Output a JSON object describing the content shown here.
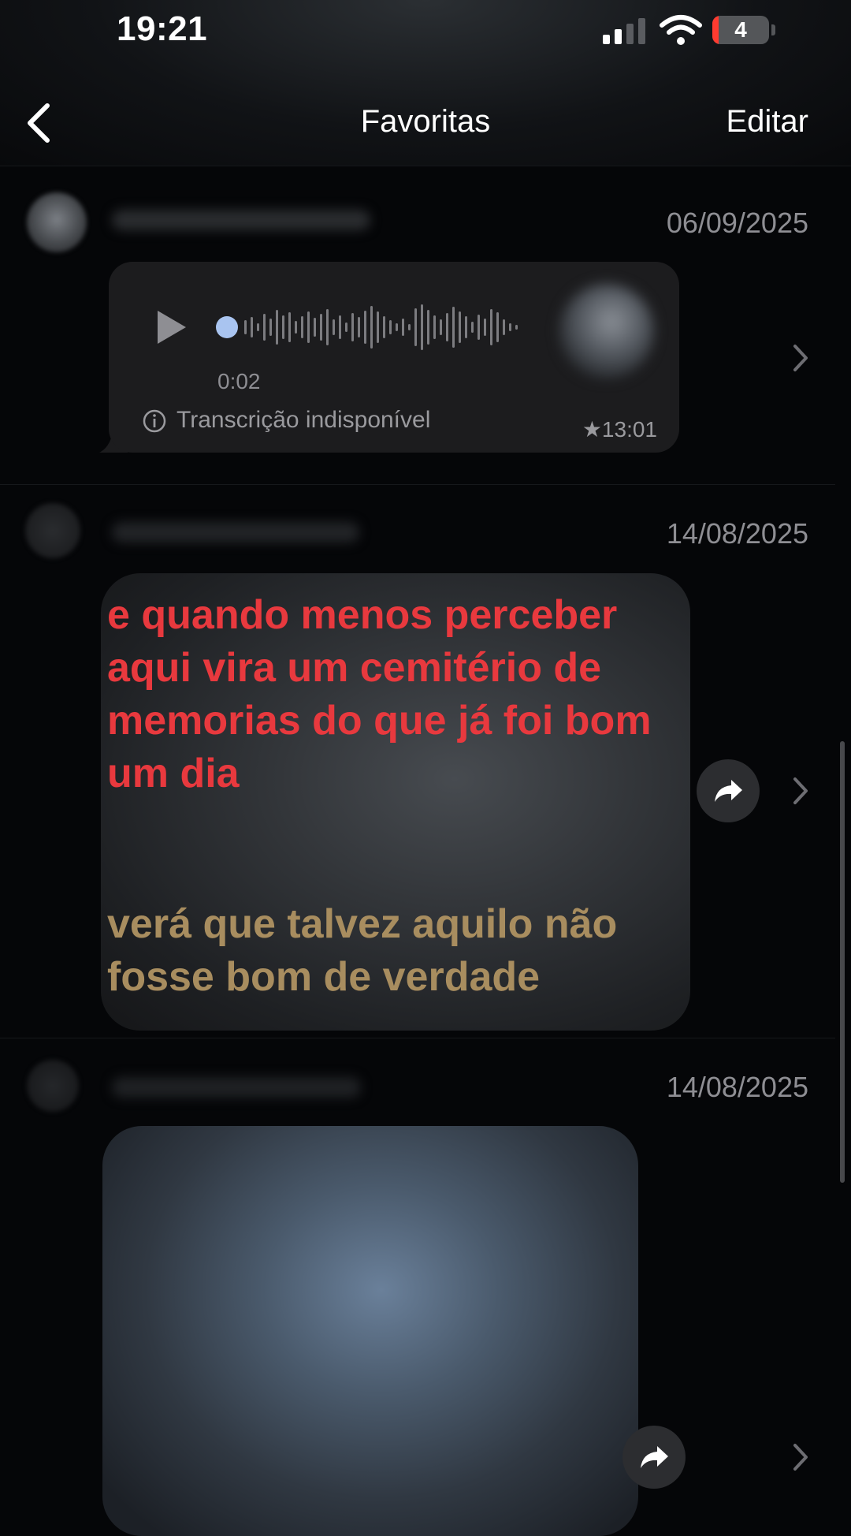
{
  "status_bar": {
    "time": "19:21",
    "battery_level": "4",
    "icons": [
      "cellular-signal-icon",
      "wifi-icon",
      "battery-icon"
    ]
  },
  "nav": {
    "title": "Favoritas",
    "edit_label": "Editar",
    "back_icon": "chevron-left-icon"
  },
  "messages": [
    {
      "type": "audio",
      "date": "06/09/2025",
      "duration": "0:02",
      "transcription": "Transcrição indisponível",
      "starred_time": "★13:01"
    },
    {
      "type": "image-text",
      "date": "14/08/2025",
      "quote_red": "e quando menos perceber aqui vira um cemitério de memorias do que já foi bom um dia",
      "quote_gold": "verá que talvez aquilo não fosse bom de verdade"
    },
    {
      "type": "image",
      "date": "14/08/2025"
    }
  ],
  "colors": {
    "background": "#050608",
    "bubble": "#1c1c1e",
    "secondary_text": "#8e8e93",
    "quote_red": "#e8393e",
    "quote_gold": "#a88d5f",
    "audio_dot": "#a9c4f0"
  }
}
